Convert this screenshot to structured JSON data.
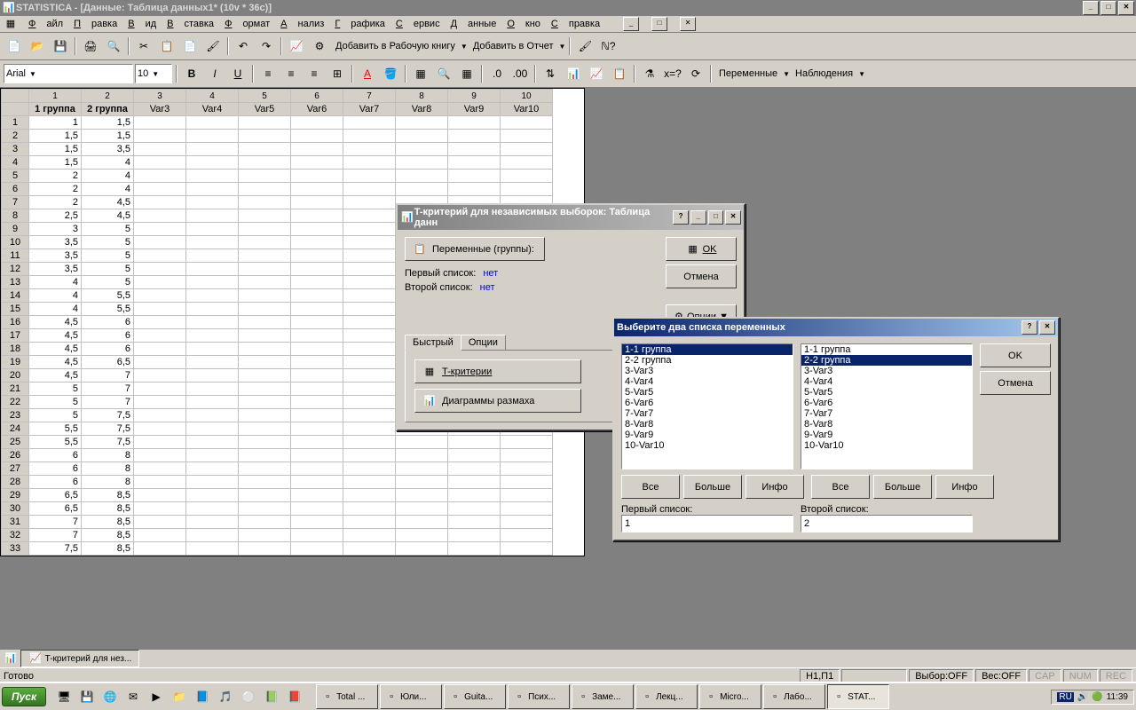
{
  "title": "STATISTICA - [Данные: Таблица данных1* (10v * 36c)]",
  "menu": [
    "Файл",
    "Правка",
    "Вид",
    "Вставка",
    "Формат",
    "Анализ",
    "Графика",
    "Сервис",
    "Данные",
    "Окно",
    "Справка"
  ],
  "toolbar1": {
    "workbook": "Добавить в Рабочую книгу",
    "report": "Добавить в Отчет"
  },
  "toolbar2": {
    "font": "Arial",
    "size": "10",
    "vars": "Переменные",
    "obs": "Наблюдения"
  },
  "sheet": {
    "colnums": [
      "1",
      "2",
      "3",
      "4",
      "5",
      "6",
      "7",
      "8",
      "9",
      "10"
    ],
    "varnames": [
      "1 группа",
      "2 группа",
      "Var3",
      "Var4",
      "Var5",
      "Var6",
      "Var7",
      "Var8",
      "Var9",
      "Var10"
    ],
    "rows": [
      [
        "1",
        "1,5",
        "",
        "",
        "",
        "",
        "",
        "",
        "",
        ""
      ],
      [
        "1,5",
        "1,5",
        "",
        "",
        "",
        "",
        "",
        "",
        "",
        ""
      ],
      [
        "1,5",
        "3,5",
        "",
        "",
        "",
        "",
        "",
        "",
        "",
        ""
      ],
      [
        "1,5",
        "4",
        "",
        "",
        "",
        "",
        "",
        "",
        "",
        ""
      ],
      [
        "2",
        "4",
        "",
        "",
        "",
        "",
        "",
        "",
        "",
        ""
      ],
      [
        "2",
        "4",
        "",
        "",
        "",
        "",
        "",
        "",
        "",
        ""
      ],
      [
        "2",
        "4,5",
        "",
        "",
        "",
        "",
        "",
        "",
        "",
        ""
      ],
      [
        "2,5",
        "4,5",
        "",
        "",
        "",
        "",
        "",
        "",
        "",
        ""
      ],
      [
        "3",
        "5",
        "",
        "",
        "",
        "",
        "",
        "",
        "",
        ""
      ],
      [
        "3,5",
        "5",
        "",
        "",
        "",
        "",
        "",
        "",
        "",
        ""
      ],
      [
        "3,5",
        "5",
        "",
        "",
        "",
        "",
        "",
        "",
        "",
        ""
      ],
      [
        "3,5",
        "5",
        "",
        "",
        "",
        "",
        "",
        "",
        "",
        ""
      ],
      [
        "4",
        "5",
        "",
        "",
        "",
        "",
        "",
        "",
        "",
        ""
      ],
      [
        "4",
        "5,5",
        "",
        "",
        "",
        "",
        "",
        "",
        "",
        ""
      ],
      [
        "4",
        "5,5",
        "",
        "",
        "",
        "",
        "",
        "",
        "",
        ""
      ],
      [
        "4,5",
        "6",
        "",
        "",
        "",
        "",
        "",
        "",
        "",
        ""
      ],
      [
        "4,5",
        "6",
        "",
        "",
        "",
        "",
        "",
        "",
        "",
        ""
      ],
      [
        "4,5",
        "6",
        "",
        "",
        "",
        "",
        "",
        "",
        "",
        ""
      ],
      [
        "4,5",
        "6,5",
        "",
        "",
        "",
        "",
        "",
        "",
        "",
        ""
      ],
      [
        "4,5",
        "7",
        "",
        "",
        "",
        "",
        "",
        "",
        "",
        ""
      ],
      [
        "5",
        "7",
        "",
        "",
        "",
        "",
        "",
        "",
        "",
        ""
      ],
      [
        "5",
        "7",
        "",
        "",
        "",
        "",
        "",
        "",
        "",
        ""
      ],
      [
        "5",
        "7,5",
        "",
        "",
        "",
        "",
        "",
        "",
        "",
        ""
      ],
      [
        "5,5",
        "7,5",
        "",
        "",
        "",
        "",
        "",
        "",
        "",
        ""
      ],
      [
        "5,5",
        "7,5",
        "",
        "",
        "",
        "",
        "",
        "",
        "",
        ""
      ],
      [
        "6",
        "8",
        "",
        "",
        "",
        "",
        "",
        "",
        "",
        ""
      ],
      [
        "6",
        "8",
        "",
        "",
        "",
        "",
        "",
        "",
        "",
        ""
      ],
      [
        "6",
        "8",
        "",
        "",
        "",
        "",
        "",
        "",
        "",
        ""
      ],
      [
        "6,5",
        "8,5",
        "",
        "",
        "",
        "",
        "",
        "",
        "",
        ""
      ],
      [
        "6,5",
        "8,5",
        "",
        "",
        "",
        "",
        "",
        "",
        "",
        ""
      ],
      [
        "7",
        "8,5",
        "",
        "",
        "",
        "",
        "",
        "",
        "",
        ""
      ],
      [
        "7",
        "8,5",
        "",
        "",
        "",
        "",
        "",
        "",
        "",
        ""
      ],
      [
        "7,5",
        "8,5",
        "",
        "",
        "",
        "",
        "",
        "",
        "",
        ""
      ]
    ]
  },
  "dialog1": {
    "title": "T-критерий для независимых выборок: Таблица данн",
    "vars_btn": "Переменные (группы):",
    "first": "Первый список:",
    "first_val": "нет",
    "second": "Второй список:",
    "second_val": "нет",
    "ok": "OK",
    "cancel": "Отмена",
    "options": "Опции",
    "tab1": "Быстрый",
    "tab2": "Опции",
    "tcrit": "T-критерии",
    "box": "Диаграммы размаха"
  },
  "dialog2": {
    "title": "Выберите два списка переменных",
    "ok": "OK",
    "cancel": "Отмена",
    "items": [
      "1-1 группа",
      "2-2 группа",
      "3-Var3",
      "4-Var4",
      "5-Var5",
      "6-Var6",
      "7-Var7",
      "8-Var8",
      "9-Var9",
      "10-Var10"
    ],
    "sel1": 0,
    "sel2": 1,
    "all": "Все",
    "more": "Больше",
    "info": "Инфо",
    "l1": "Первый список:",
    "l2": "Второй список:",
    "v1": "1",
    "v2": "2"
  },
  "docbar": {
    "tab": "T-критерий для нез..."
  },
  "status": {
    "ready": "Готово",
    "cell": "Н1,П1",
    "sel": "Выбор:OFF",
    "weight": "Вес:OFF",
    "cap": "CAP",
    "num": "NUM",
    "rec": "REC"
  },
  "taskbar": {
    "start": "Пуск",
    "tasks": [
      "Total ...",
      "Юли...",
      "Guita...",
      "Псих...",
      "Заме...",
      "Лекц...",
      "Micro...",
      "Лабо...",
      "STAT..."
    ],
    "active": 8,
    "lang": "RU",
    "time": "11:39"
  }
}
